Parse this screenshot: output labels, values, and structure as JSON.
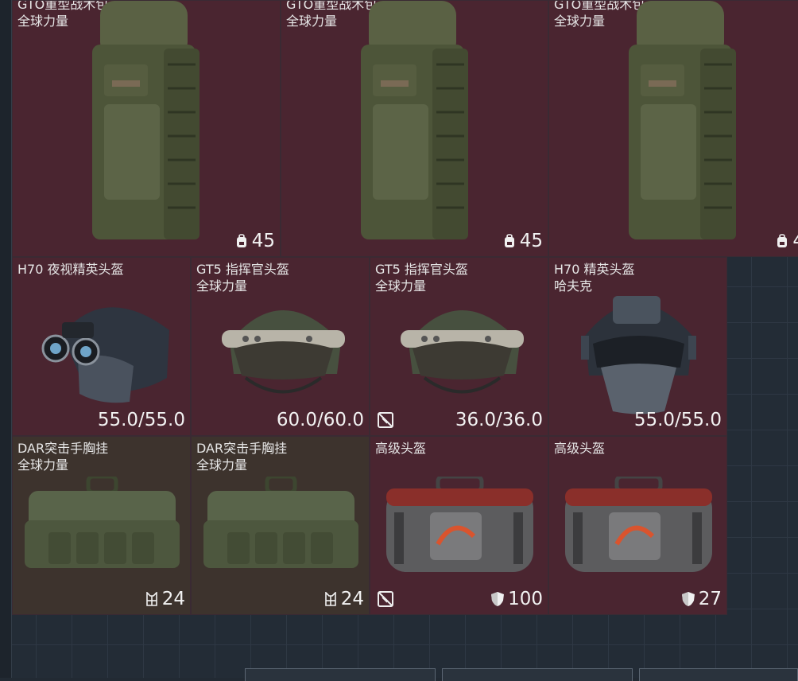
{
  "row1": [
    {
      "line1": "GTO重型战术包",
      "line2": "全球力量",
      "stat": "45",
      "stat_icon": "backpack-icon"
    },
    {
      "line1": "GTO重型战术包",
      "line2": "全球力量",
      "stat": "45",
      "stat_icon": "backpack-icon"
    },
    {
      "line1": "GTO重型战术包",
      "line2": "全球力量",
      "stat": "4",
      "stat_icon": "backpack-icon"
    }
  ],
  "row2": [
    {
      "line1": "H70 夜视精英头盔",
      "line2": "",
      "stat": "55.0/55.0"
    },
    {
      "line1": "GT5 指挥官头盔",
      "line2": "全球力量",
      "stat": "60.0/60.0"
    },
    {
      "line1": "GT5 指挥官头盔",
      "line2": "全球力量",
      "stat": "36.0/36.0"
    },
    {
      "line1": "H70 精英头盔",
      "line2": "哈夫克",
      "stat": "55.0/55.0"
    }
  ],
  "row3": [
    {
      "line1": "DAR突击手胸挂",
      "line2": "全球力量",
      "stat": "24",
      "stat_icon": "chest-rig-icon"
    },
    {
      "line1": "DAR突击手胸挂",
      "line2": "全球力量",
      "stat": "24",
      "stat_icon": "chest-rig-icon"
    },
    {
      "line1": "高级头盔",
      "line2": "",
      "stat": "100",
      "stat_icon": "armor-shield-icon"
    },
    {
      "line1": "高级头盔",
      "line2": "",
      "stat": "27",
      "stat_icon": "armor-shield-icon"
    }
  ],
  "colors": {
    "cell_red": "#4a2530",
    "cell_olive": "#3d332d",
    "background": "#232c36"
  }
}
